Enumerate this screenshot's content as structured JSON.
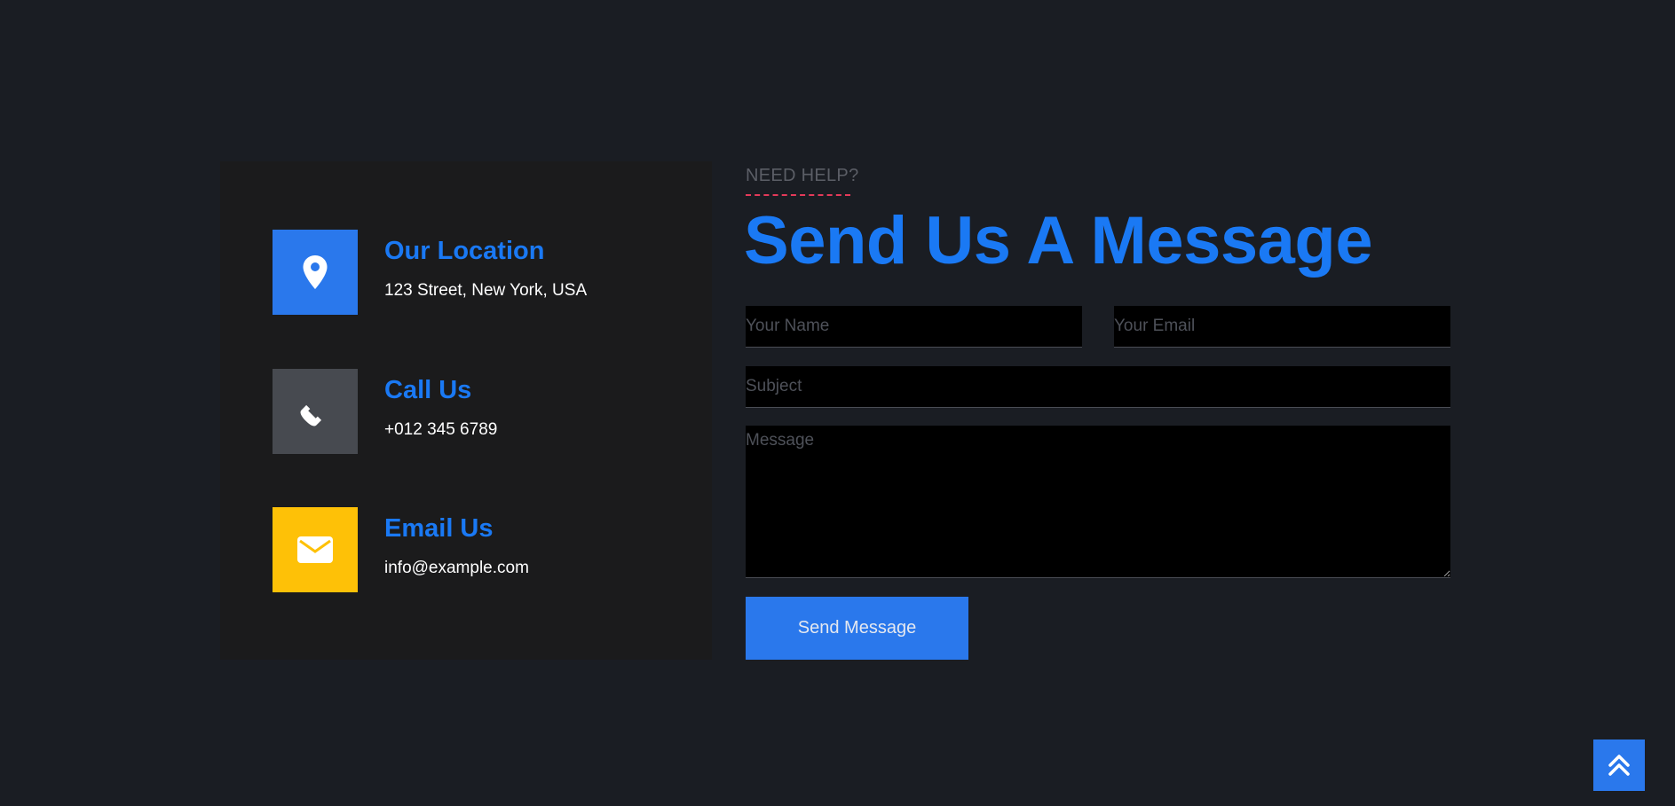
{
  "contact_info": [
    {
      "title": "Our Location",
      "value": "123 Street, New York, USA",
      "icon": "map-marker-icon",
      "icon_bg": "#2a78ec"
    },
    {
      "title": "Call Us",
      "value": "+012 345 6789",
      "icon": "phone-icon",
      "icon_bg": "#474a50"
    },
    {
      "title": "Email Us",
      "value": "info@example.com",
      "icon": "envelope-icon",
      "icon_bg": "#fec107"
    }
  ],
  "form": {
    "eyebrow": "NEED HELP?",
    "heading": "Send Us A Message",
    "name_placeholder": "Your Name",
    "email_placeholder": "Your Email",
    "subject_placeholder": "Subject",
    "message_placeholder": "Message",
    "submit_label": "Send Message"
  },
  "back_to_top": {
    "icon": "double-chevron-up-icon"
  },
  "colors": {
    "background": "#1a1d23",
    "panel": "#1b1b1c",
    "accent": "#1a79f4",
    "button": "#2a78ec",
    "eyebrow_underline": "#e43a5a"
  }
}
